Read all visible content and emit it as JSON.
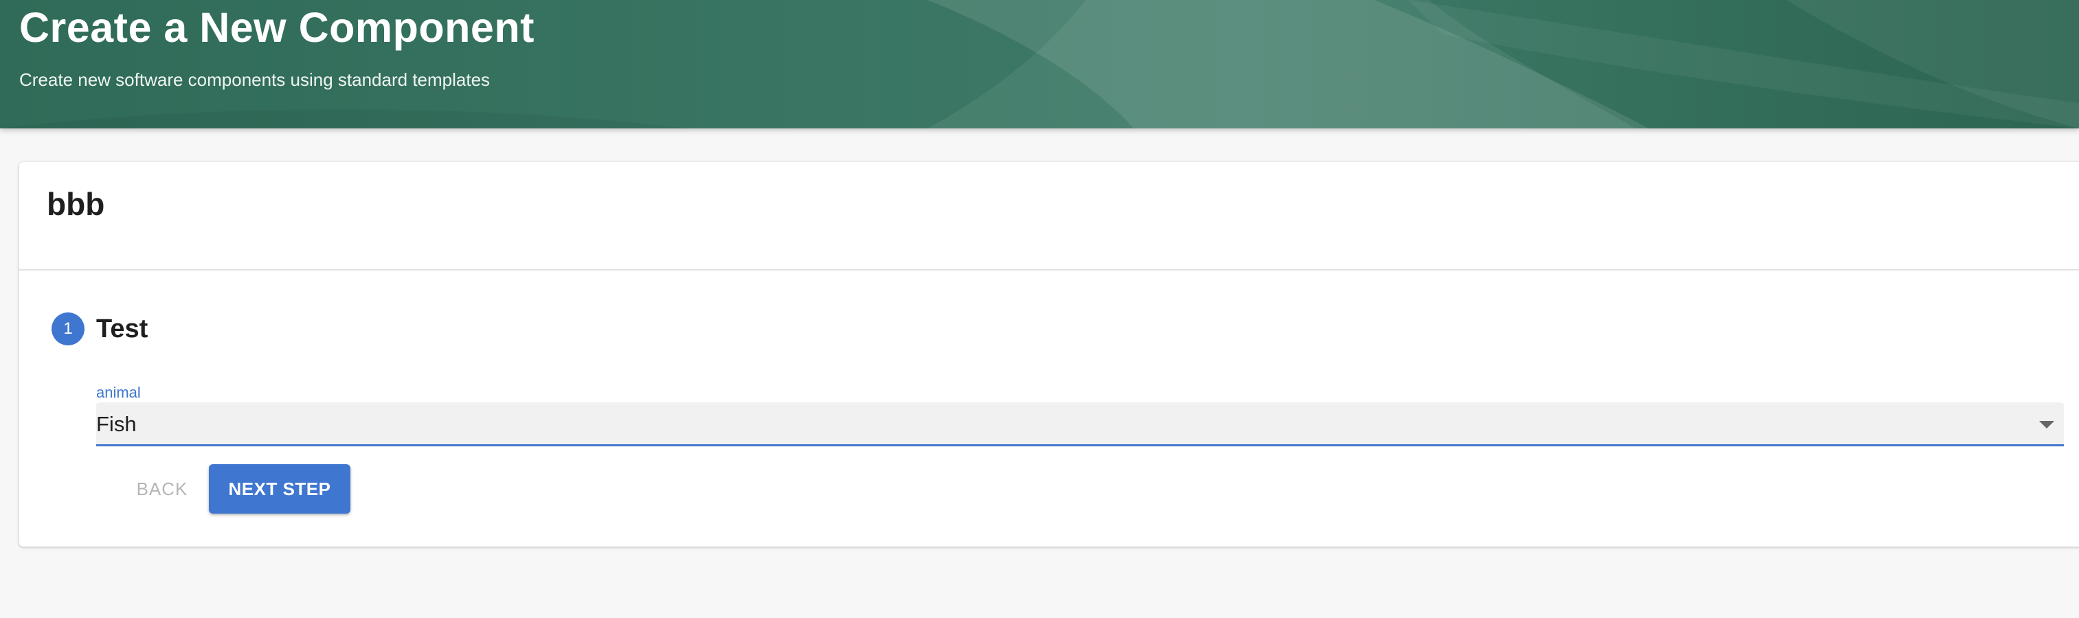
{
  "header": {
    "title": "Create a New Component",
    "subtitle": "Create new software components using standard templates"
  },
  "template": {
    "name": "bbb"
  },
  "step": {
    "number": "1",
    "title": "Test"
  },
  "field": {
    "label": "animal",
    "value": "Fish"
  },
  "actions": {
    "back_label": "BACK",
    "next_label": "NEXT STEP"
  },
  "colors": {
    "header_bg": "#3a7563",
    "accent": "#3f76d0",
    "page_bg": "#f7f7f7"
  }
}
